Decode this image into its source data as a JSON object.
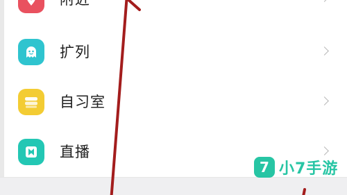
{
  "menu": {
    "items": [
      {
        "label": "附近",
        "icon": "location-pin-icon",
        "color": "#e9515f"
      },
      {
        "label": "扩列",
        "icon": "ghost-face-icon",
        "color": "#2fc4cf"
      },
      {
        "label": "自习室",
        "icon": "book-stack-icon",
        "color": "#f3cc33"
      },
      {
        "label": "直播",
        "icon": "live-stream-icon",
        "color": "#23c7b4"
      }
    ]
  },
  "annotation": {
    "color": "#a31d1d",
    "type": "arrow-up"
  },
  "watermark": {
    "badge": "7",
    "text": "小7手游",
    "color": "#27c5a4"
  }
}
